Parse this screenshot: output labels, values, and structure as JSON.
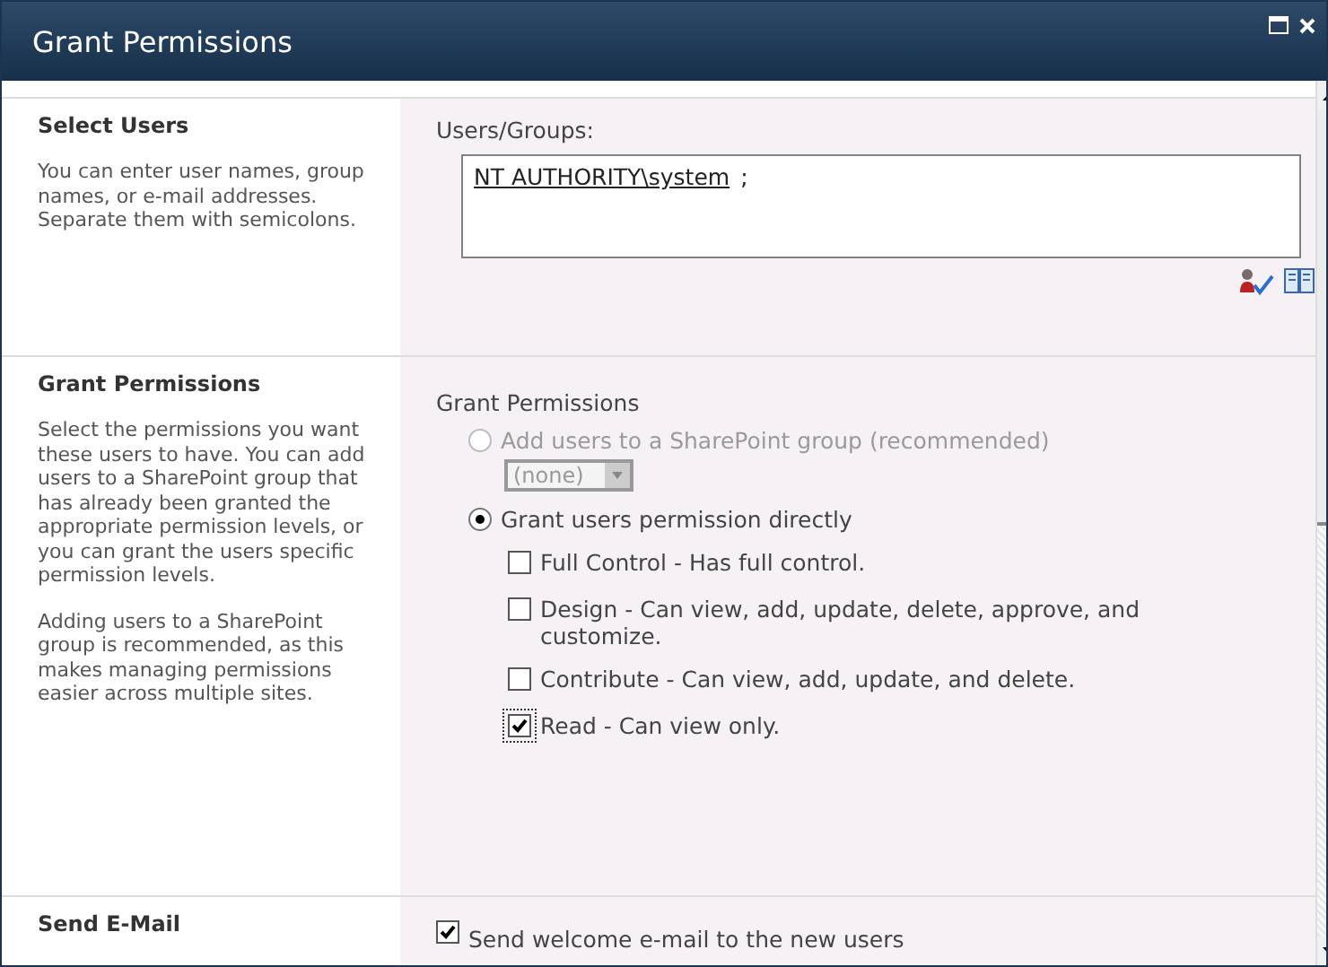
{
  "window": {
    "title": "Grant Permissions"
  },
  "select_users": {
    "title": "Select Users",
    "description": "You can enter user names, group names, or e-mail addresses. Separate them with semicolons.",
    "field_label": "Users/Groups:",
    "entries": [
      {
        "name": "NT AUTHORITY\\system",
        "separator": ";"
      }
    ]
  },
  "grant_permissions": {
    "title": "Grant Permissions",
    "description": [
      "Select the permissions you want these users to have. You can add users to a SharePoint group that has already been granted the appropriate permission levels, or you can grant the users specific permission levels.",
      "Adding users to a SharePoint group is recommended, as this makes managing permissions easier across multiple sites."
    ],
    "group_label": "Grant Permissions",
    "options": [
      {
        "label": "Add users to a SharePoint group (recommended)",
        "selected": false,
        "disabled": true,
        "dropdown": {
          "value": "(none)",
          "disabled": true
        }
      },
      {
        "label": "Grant users permission directly",
        "selected": true,
        "disabled": false
      }
    ],
    "permissions": [
      {
        "label": "Full Control - Has full control.",
        "checked": false,
        "focused": false
      },
      {
        "label": "Design - Can view, add, update, delete, approve, and customize.",
        "checked": false,
        "focused": false
      },
      {
        "label": "Contribute - Can view, add, update, and delete.",
        "checked": false,
        "focused": false
      },
      {
        "label": "Read - Can view only.",
        "checked": true,
        "focused": true
      }
    ]
  },
  "send_email": {
    "title": "Send E-Mail",
    "option": {
      "label": "Send welcome e-mail to the new users",
      "checked": true
    }
  }
}
